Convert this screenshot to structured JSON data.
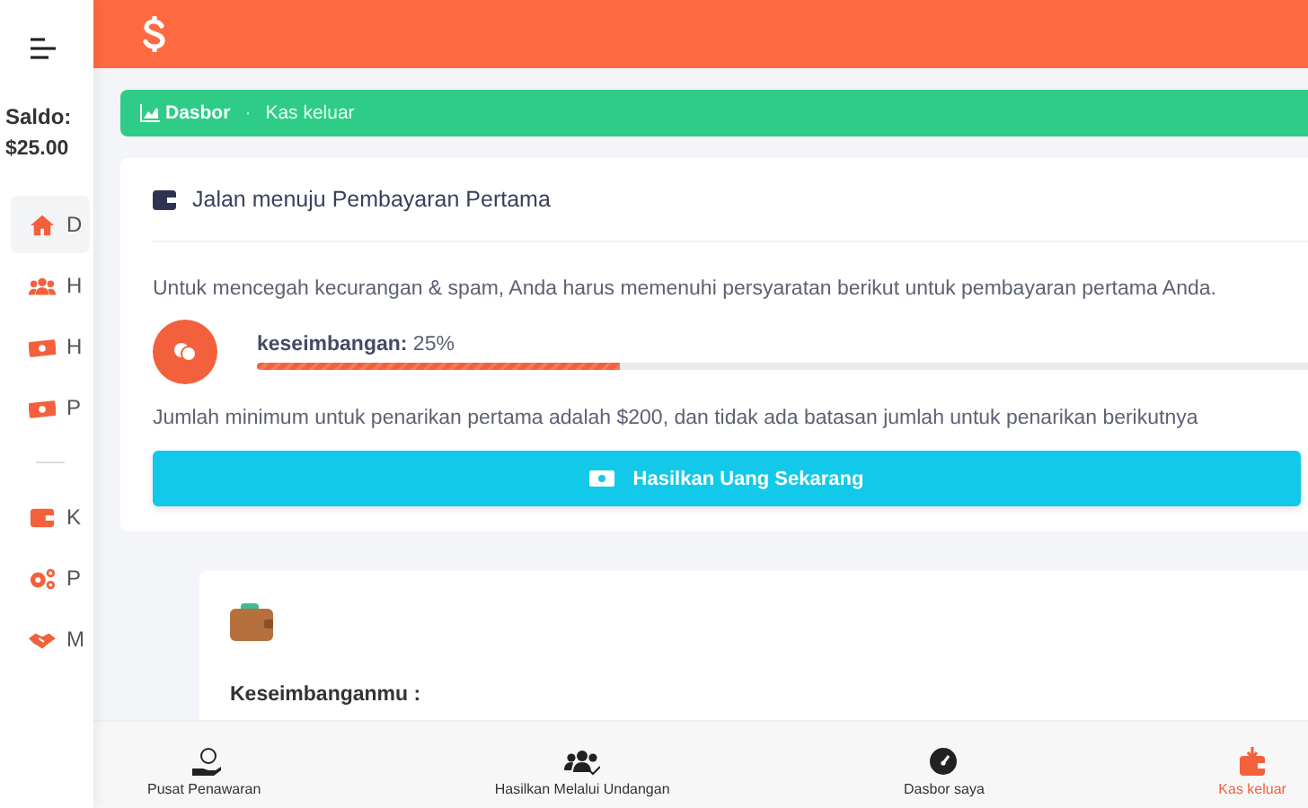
{
  "sidebar": {
    "balance_label": "Saldo:",
    "balance": "$25.00",
    "groups": [
      [
        {
          "label": "D",
          "selected": true
        },
        {
          "label": "H",
          "selected": false
        },
        {
          "label": "H",
          "selected": false
        },
        {
          "label": "P",
          "selected": false
        }
      ],
      [
        {
          "label": "K",
          "selected": false
        },
        {
          "label": "P",
          "selected": false
        },
        {
          "label": "M",
          "selected": false
        }
      ]
    ]
  },
  "breadcrumb": {
    "items": [
      "Dasbor",
      "Kas keluar"
    ],
    "separator": "·"
  },
  "payout_card": {
    "title": "Jalan menuju Pembayaran Pertama",
    "intro": "Untuk mencegah kecurangan & spam, Anda harus memenuhi persyaratan berikut untuk pembayaran pertama Anda.",
    "progress": {
      "label": "keseimbangan:",
      "reading": "25%",
      "level": 0.25
    },
    "note": "Jumlah minimum untuk penarikan pertama adalah $200, dan tidak ada batasan jumlah untuk penarikan berikutnya",
    "button": "Hasilkan Uang Sekarang"
  },
  "balance_card": {
    "label": "Keseimbanganmu :"
  },
  "bottom_nav": [
    {
      "label": "Pusat Penawaran",
      "selected": false
    },
    {
      "label": "Hasilkan Melalui Undangan",
      "selected": false
    },
    {
      "label": "Dasbor saya",
      "selected": false
    },
    {
      "label": "Kas keluar",
      "selected": true
    }
  ]
}
